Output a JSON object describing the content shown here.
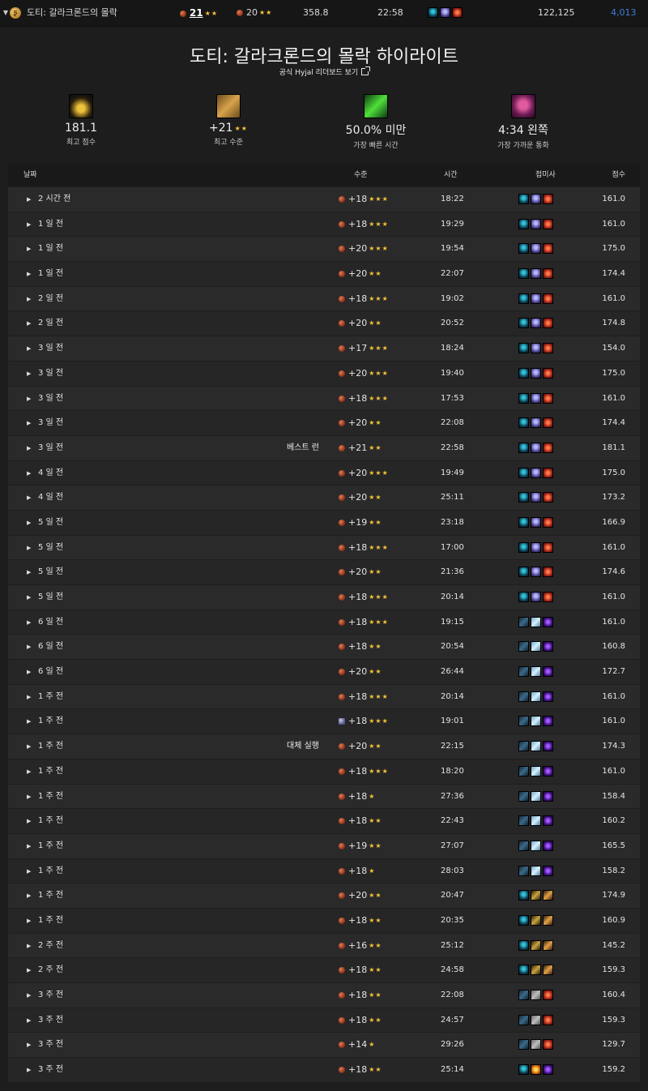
{
  "topbar": {
    "dungeon": "도티: 갈라크론드의 몰락",
    "level": "21",
    "level_stars": "★★",
    "level2": "20",
    "level2_stars": "★★",
    "score": "358.8",
    "time": "22:58",
    "points": "122,125",
    "rank": "4,013"
  },
  "header": {
    "title": "도티: 갈라크론드의 몰락 하이라이트",
    "link": "공식 Hyjal 리더보드 보기"
  },
  "stats": [
    {
      "value": "181.1",
      "label": "최고 점수"
    },
    {
      "value": "+21",
      "stars": "★★",
      "label": "최고 수준"
    },
    {
      "value": "50.0% 미만",
      "label": "가장 빠른 시간"
    },
    {
      "value": "4:34 왼쪽",
      "label": "가장 가까운 통화"
    }
  ],
  "table": {
    "headers": {
      "date": "날짜",
      "level": "수준",
      "time": "시간",
      "comp": "접미사",
      "score": "점수"
    },
    "rows": [
      {
        "date": "2 시간 전",
        "note": "",
        "level": "+18",
        "stars": "★★★",
        "time": "18:22",
        "comp": [
          "blood",
          "vengeance",
          "resto"
        ],
        "score": "161.0"
      },
      {
        "date": "1 일 전",
        "note": "",
        "level": "+18",
        "stars": "★★★",
        "time": "19:29",
        "comp": [
          "blood",
          "vengeance",
          "resto"
        ],
        "score": "161.0"
      },
      {
        "date": "1 일 전",
        "note": "",
        "level": "+20",
        "stars": "★★★",
        "time": "19:54",
        "comp": [
          "blood",
          "vengeance",
          "resto"
        ],
        "score": "175.0"
      },
      {
        "date": "1 일 전",
        "note": "",
        "level": "+20",
        "stars": "★★",
        "time": "22:07",
        "comp": [
          "blood",
          "vengeance",
          "resto"
        ],
        "score": "174.4"
      },
      {
        "date": "2 일 전",
        "note": "",
        "level": "+18",
        "stars": "★★★",
        "time": "19:02",
        "comp": [
          "blood",
          "vengeance",
          "resto"
        ],
        "score": "161.0"
      },
      {
        "date": "2 일 전",
        "note": "",
        "level": "+20",
        "stars": "★★",
        "time": "20:52",
        "comp": [
          "blood",
          "vengeance",
          "resto"
        ],
        "score": "174.8"
      },
      {
        "date": "3 일 전",
        "note": "",
        "level": "+17",
        "stars": "★★★",
        "time": "18:24",
        "comp": [
          "blood",
          "vengeance",
          "resto"
        ],
        "score": "154.0"
      },
      {
        "date": "3 일 전",
        "note": "",
        "level": "+20",
        "stars": "★★★",
        "time": "19:40",
        "comp": [
          "blood",
          "vengeance",
          "resto"
        ],
        "score": "175.0"
      },
      {
        "date": "3 일 전",
        "note": "",
        "level": "+18",
        "stars": "★★★",
        "time": "17:53",
        "comp": [
          "blood",
          "vengeance",
          "resto"
        ],
        "score": "161.0"
      },
      {
        "date": "3 일 전",
        "note": "",
        "level": "+20",
        "stars": "★★",
        "time": "22:08",
        "comp": [
          "blood",
          "vengeance",
          "resto"
        ],
        "score": "174.4"
      },
      {
        "date": "3 일 전",
        "note": "베스트 런",
        "level": "+21",
        "stars": "★★",
        "time": "22:58",
        "comp": [
          "blood",
          "vengeance",
          "resto"
        ],
        "score": "181.1"
      },
      {
        "date": "4 일 전",
        "note": "",
        "level": "+20",
        "stars": "★★★",
        "time": "19:49",
        "comp": [
          "blood",
          "vengeance",
          "resto"
        ],
        "score": "175.0"
      },
      {
        "date": "4 일 전",
        "note": "",
        "level": "+20",
        "stars": "★★",
        "time": "25:11",
        "comp": [
          "blood",
          "vengeance",
          "resto"
        ],
        "score": "173.2"
      },
      {
        "date": "5 일 전",
        "note": "",
        "level": "+19",
        "stars": "★★",
        "time": "23:18",
        "comp": [
          "blood",
          "vengeance",
          "resto"
        ],
        "score": "166.9"
      },
      {
        "date": "5 일 전",
        "note": "",
        "level": "+18",
        "stars": "★★★",
        "time": "17:00",
        "comp": [
          "blood",
          "vengeance",
          "resto"
        ],
        "score": "161.0"
      },
      {
        "date": "5 일 전",
        "note": "",
        "level": "+20",
        "stars": "★★",
        "time": "21:36",
        "comp": [
          "blood",
          "vengeance",
          "resto"
        ],
        "score": "174.6"
      },
      {
        "date": "5 일 전",
        "note": "",
        "level": "+18",
        "stars": "★★★",
        "time": "20:14",
        "comp": [
          "blood",
          "vengeance",
          "resto"
        ],
        "score": "161.0"
      },
      {
        "date": "6 일 전",
        "note": "",
        "level": "+18",
        "stars": "★★★",
        "time": "19:15",
        "comp": [
          "frost",
          "ice",
          "shadow"
        ],
        "score": "161.0"
      },
      {
        "date": "6 일 전",
        "note": "",
        "level": "+18",
        "stars": "★★",
        "time": "20:54",
        "comp": [
          "frost",
          "ice",
          "shadow"
        ],
        "score": "160.8"
      },
      {
        "date": "6 일 전",
        "note": "",
        "level": "+20",
        "stars": "★★",
        "time": "26:44",
        "comp": [
          "frost",
          "ice",
          "shadow"
        ],
        "score": "172.7"
      },
      {
        "date": "1 주 전",
        "note": "",
        "level": "+18",
        "stars": "★★★",
        "time": "20:14",
        "comp": [
          "frost",
          "ice",
          "shadow"
        ],
        "score": "161.0"
      },
      {
        "date": "1 주 전",
        "note": "",
        "level": "+18",
        "stars": "★★★",
        "time": "19:01",
        "comp": [
          "frost",
          "ice",
          "shadow"
        ],
        "score": "161.0",
        "altkey": true
      },
      {
        "date": "1 주 전",
        "note": "대체 실행",
        "level": "+20",
        "stars": "★★",
        "time": "22:15",
        "comp": [
          "frost",
          "ice",
          "shadow"
        ],
        "score": "174.3"
      },
      {
        "date": "1 주 전",
        "note": "",
        "level": "+18",
        "stars": "★★★",
        "time": "18:20",
        "comp": [
          "frost",
          "ice",
          "shadow"
        ],
        "score": "161.0"
      },
      {
        "date": "1 주 전",
        "note": "",
        "level": "+18",
        "stars": "★",
        "time": "27:36",
        "comp": [
          "frost",
          "ice",
          "shadow"
        ],
        "score": "158.4"
      },
      {
        "date": "1 주 전",
        "note": "",
        "level": "+18",
        "stars": "★★",
        "time": "22:43",
        "comp": [
          "frost",
          "ice",
          "shadow"
        ],
        "score": "160.2"
      },
      {
        "date": "1 주 전",
        "note": "",
        "level": "+19",
        "stars": "★★",
        "time": "27:07",
        "comp": [
          "frost",
          "ice",
          "shadow"
        ],
        "score": "165.5"
      },
      {
        "date": "1 주 전",
        "note": "",
        "level": "+18",
        "stars": "★",
        "time": "28:03",
        "comp": [
          "frost",
          "ice",
          "shadow"
        ],
        "score": "158.2"
      },
      {
        "date": "1 주 전",
        "note": "",
        "level": "+20",
        "stars": "★★",
        "time": "20:47",
        "comp": [
          "blood",
          "guardian",
          "fire"
        ],
        "score": "174.9"
      },
      {
        "date": "1 주 전",
        "note": "",
        "level": "+18",
        "stars": "★★",
        "time": "20:35",
        "comp": [
          "blood",
          "guardian",
          "fire"
        ],
        "score": "160.9"
      },
      {
        "date": "2 주 전",
        "note": "",
        "level": "+16",
        "stars": "★★",
        "time": "25:12",
        "comp": [
          "blood",
          "guardian",
          "fire"
        ],
        "score": "145.2"
      },
      {
        "date": "2 주 전",
        "note": "",
        "level": "+18",
        "stars": "★★",
        "time": "24:58",
        "comp": [
          "blood",
          "guardian",
          "fire"
        ],
        "score": "159.3"
      },
      {
        "date": "3 주 전",
        "note": "",
        "level": "+18",
        "stars": "★★",
        "time": "22:08",
        "comp": [
          "frost",
          "stone",
          "resto"
        ],
        "score": "160.4"
      },
      {
        "date": "3 주 전",
        "note": "",
        "level": "+18",
        "stars": "★★",
        "time": "24:57",
        "comp": [
          "frost",
          "stone",
          "resto"
        ],
        "score": "159.3"
      },
      {
        "date": "3 주 전",
        "note": "",
        "level": "+14",
        "stars": "★",
        "time": "29:26",
        "comp": [
          "frost",
          "stone",
          "resto"
        ],
        "score": "129.7"
      },
      {
        "date": "3 주 전",
        "note": "",
        "level": "+18",
        "stars": "★★",
        "time": "25:14",
        "comp": [
          "blood",
          "flame",
          "shadow"
        ],
        "score": "159.2"
      }
    ]
  }
}
